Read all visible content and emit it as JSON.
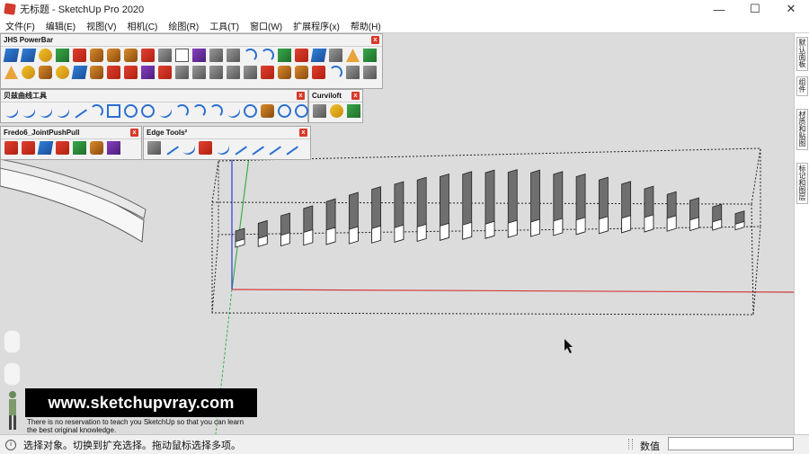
{
  "window": {
    "title": "无标题 - SketchUp Pro 2020",
    "min": "—",
    "max": "☐",
    "close": "✕"
  },
  "menu": [
    "文件(F)",
    "编辑(E)",
    "视图(V)",
    "相机(C)",
    "绘图(R)",
    "工具(T)",
    "窗口(W)",
    "扩展程序(x)",
    "帮助(H)"
  ],
  "toolbars": {
    "jhs": {
      "title": "JHS PowerBar",
      "close": "x"
    },
    "bezier": {
      "title": "贝兹曲线工具",
      "close": "x"
    },
    "curviloft": {
      "title": "Curviloft",
      "close": "x"
    },
    "fredo": {
      "title": "Fredo6_JointPushPull",
      "close": "x"
    },
    "edge": {
      "title": "Edge Tools²",
      "close": "x"
    }
  },
  "tray": [
    "默认面板",
    "组件",
    "材质和贴图",
    "标记和图层"
  ],
  "watermark": {
    "url": "www.sketchupvray.com",
    "line1": "There is no reservation to teach you SketchUp so that you can learn",
    "line2": "the best original knowledge."
  },
  "status": {
    "info_icon": "i",
    "text": "选择对象。切换到扩充选择。拖动鼠标选择多项。",
    "measure_label": "数值",
    "measure_value": ""
  },
  "colors": {
    "axis_red": "#d43a3a",
    "axis_green": "#3bb04a",
    "axis_blue": "#2a3fd6"
  }
}
